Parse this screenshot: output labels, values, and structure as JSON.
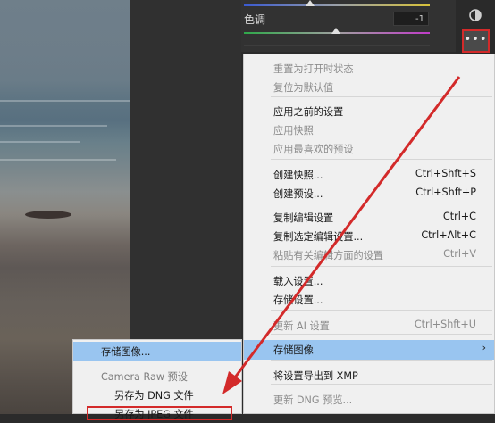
{
  "panel": {
    "hue_label": "色调",
    "hue_value": "-1"
  },
  "toolbar": {
    "more_label": "•••",
    "mask_icon": "mask-circle-icon"
  },
  "menu": {
    "items": [
      {
        "label": "重置为打开时状态",
        "shortcut": "",
        "disabled": true
      },
      {
        "label": "复位为默认值",
        "shortcut": "",
        "disabled": true
      },
      {
        "label": "应用之前的设置",
        "shortcut": "",
        "disabled": false
      },
      {
        "label": "应用快照",
        "shortcut": "",
        "disabled": true
      },
      {
        "label": "应用最喜欢的预设",
        "shortcut": "",
        "disabled": true
      },
      {
        "label": "创建快照...",
        "shortcut": "Ctrl+Shft+S",
        "disabled": false
      },
      {
        "label": "创建预设...",
        "shortcut": "Ctrl+Shft+P",
        "disabled": false
      },
      {
        "label": "复制编辑设置",
        "shortcut": "Ctrl+C",
        "disabled": false
      },
      {
        "label": "复制选定编辑设置...",
        "shortcut": "Ctrl+Alt+C",
        "disabled": false
      },
      {
        "label": "粘贴有关编辑方面的设置",
        "shortcut": "Ctrl+V",
        "disabled": true
      },
      {
        "label": "载入设置...",
        "shortcut": "",
        "disabled": false
      },
      {
        "label": "存储设置...",
        "shortcut": "",
        "disabled": false
      },
      {
        "label": "更新 AI 设置",
        "shortcut": "Ctrl+Shft+U",
        "disabled": true
      },
      {
        "label": "存储图像",
        "shortcut": "",
        "disabled": false,
        "arrow": "›"
      },
      {
        "label": "将设置导出到 XMP",
        "shortcut": "",
        "disabled": false
      },
      {
        "label": "更新 DNG 预览...",
        "shortcut": "",
        "disabled": true
      }
    ]
  },
  "submenu": {
    "items": [
      {
        "label": "存储图像..."
      },
      {
        "label": "Camera Raw 预设"
      },
      {
        "label": "另存为 DNG 文件"
      },
      {
        "label": "另存为 JPEG 文件"
      }
    ]
  },
  "colors": {
    "highlight": "#99c5f0",
    "annotation_red": "#d32a2a"
  }
}
